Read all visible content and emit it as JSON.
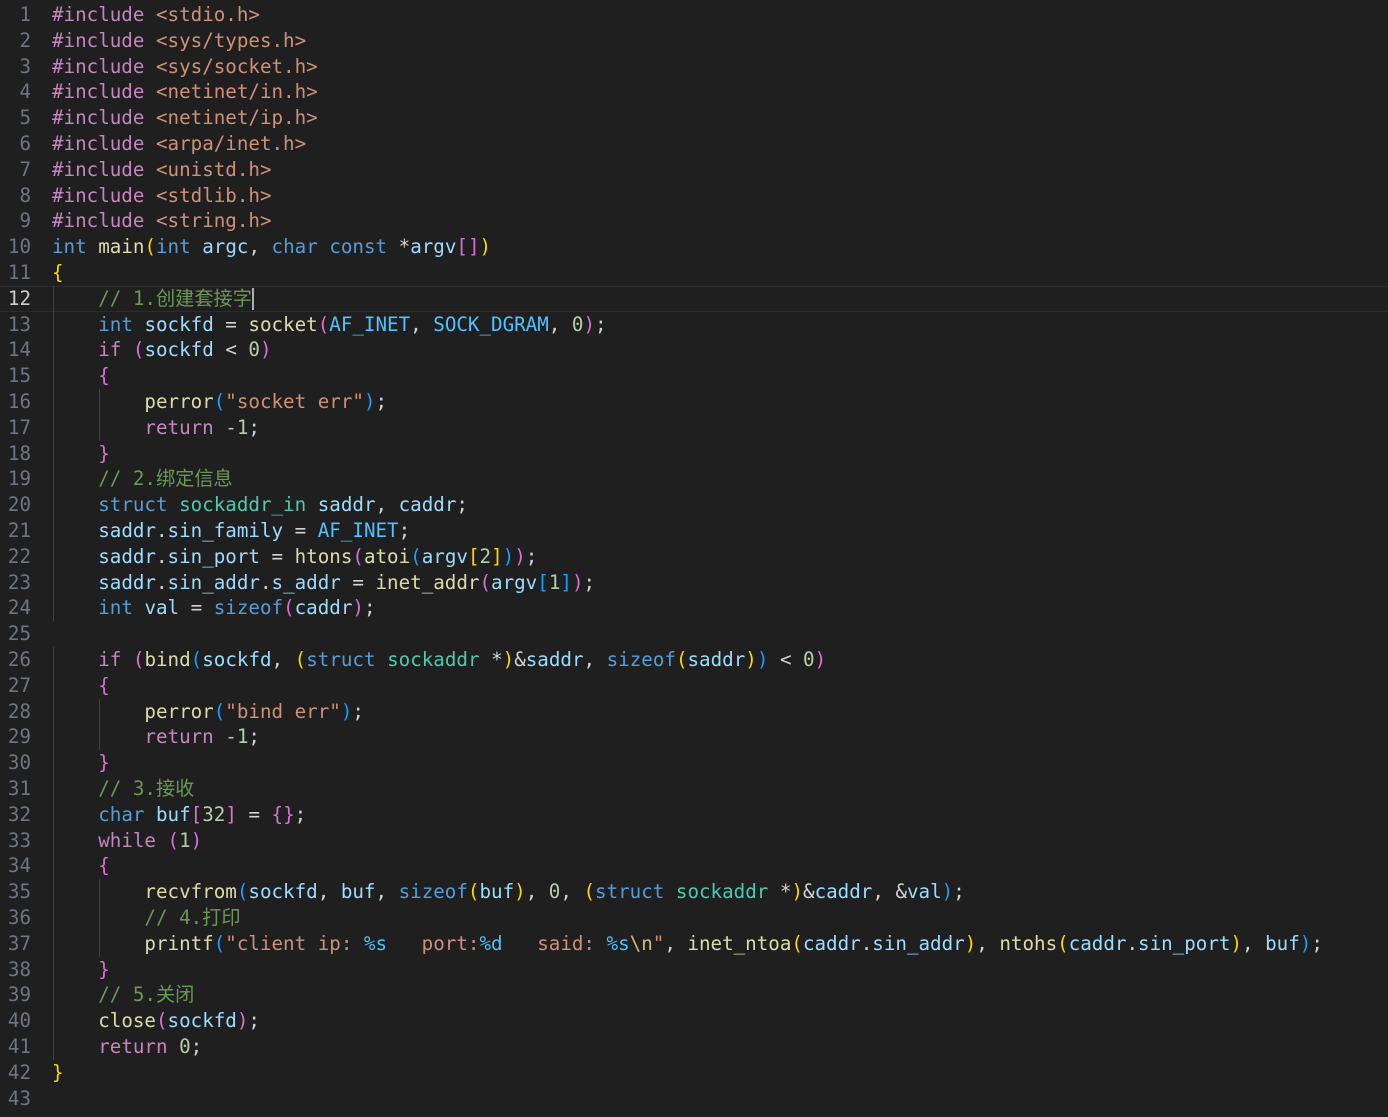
{
  "editor": {
    "language": "c",
    "current_line": 12,
    "colors": {
      "background": "#1f1f1f",
      "line_number": "#6e7681",
      "line_number_active": "#cccccc",
      "keyword_control": "#c586c0",
      "keyword_type": "#569cd6",
      "type_name": "#4ec9b0",
      "function": "#dcdcaa",
      "variable": "#9cdcfe",
      "constant": "#4fc1ff",
      "string": "#ce9178",
      "number": "#b5cea8",
      "comment": "#6a9955",
      "bracket_gold": "#ffd700",
      "bracket_purple": "#da70d6",
      "bracket_blue": "#179fff"
    },
    "lines": [
      [
        [
          "#include",
          "kwc"
        ],
        [
          " ",
          "p"
        ],
        [
          "<stdio.h>",
          "s"
        ]
      ],
      [
        [
          "#include",
          "kwc"
        ],
        [
          " ",
          "p"
        ],
        [
          "<sys/types.h>",
          "s"
        ]
      ],
      [
        [
          "#include",
          "kwc"
        ],
        [
          " ",
          "p"
        ],
        [
          "<sys/socket.h>",
          "s"
        ]
      ],
      [
        [
          "#include",
          "kwc"
        ],
        [
          " ",
          "p"
        ],
        [
          "<netinet/in.h>",
          "s"
        ]
      ],
      [
        [
          "#include",
          "kwc"
        ],
        [
          " ",
          "p"
        ],
        [
          "<netinet/ip.h>",
          "s"
        ]
      ],
      [
        [
          "#include",
          "kwc"
        ],
        [
          " ",
          "p"
        ],
        [
          "<arpa/inet.h>",
          "s"
        ]
      ],
      [
        [
          "#include",
          "kwc"
        ],
        [
          " ",
          "p"
        ],
        [
          "<unistd.h>",
          "s"
        ]
      ],
      [
        [
          "#include",
          "kwc"
        ],
        [
          " ",
          "p"
        ],
        [
          "<stdlib.h>",
          "s"
        ]
      ],
      [
        [
          "#include",
          "kwc"
        ],
        [
          " ",
          "p"
        ],
        [
          "<string.h>",
          "s"
        ]
      ],
      [
        [
          "int",
          "kw"
        ],
        [
          " ",
          "p"
        ],
        [
          "main",
          "f"
        ],
        [
          "(",
          "b1"
        ],
        [
          "int",
          "kw"
        ],
        [
          " ",
          "p"
        ],
        [
          "argc",
          "v"
        ],
        [
          ", ",
          "p"
        ],
        [
          "char",
          "kw"
        ],
        [
          " ",
          "p"
        ],
        [
          "const",
          "kw"
        ],
        [
          " *",
          "p"
        ],
        [
          "argv",
          "v"
        ],
        [
          "[]",
          "b2"
        ],
        [
          ")",
          "b1"
        ]
      ],
      [
        [
          "{",
          "b1"
        ]
      ],
      [
        [
          "    ",
          "p"
        ],
        [
          "// 1.创建套接字",
          "c"
        ]
      ],
      [
        [
          "    ",
          "p"
        ],
        [
          "int",
          "kw"
        ],
        [
          " ",
          "p"
        ],
        [
          "sockfd",
          "v"
        ],
        [
          " = ",
          "p"
        ],
        [
          "socket",
          "f"
        ],
        [
          "(",
          "b2"
        ],
        [
          "AF_INET",
          "k"
        ],
        [
          ", ",
          "p"
        ],
        [
          "SOCK_DGRAM",
          "k"
        ],
        [
          ", ",
          "p"
        ],
        [
          "0",
          "n"
        ],
        [
          ")",
          "b2"
        ],
        [
          ";",
          "p"
        ]
      ],
      [
        [
          "    ",
          "p"
        ],
        [
          "if",
          "kwc"
        ],
        [
          " ",
          "p"
        ],
        [
          "(",
          "b2"
        ],
        [
          "sockfd",
          "v"
        ],
        [
          " < ",
          "p"
        ],
        [
          "0",
          "n"
        ],
        [
          ")",
          "b2"
        ]
      ],
      [
        [
          "    ",
          "p"
        ],
        [
          "{",
          "b2"
        ]
      ],
      [
        [
          "        ",
          "p"
        ],
        [
          "perror",
          "f"
        ],
        [
          "(",
          "b3"
        ],
        [
          "\"socket err\"",
          "s"
        ],
        [
          ")",
          "b3"
        ],
        [
          ";",
          "p"
        ]
      ],
      [
        [
          "        ",
          "p"
        ],
        [
          "return",
          "kwc"
        ],
        [
          " ",
          "p"
        ],
        [
          "-1",
          "n"
        ],
        [
          ";",
          "p"
        ]
      ],
      [
        [
          "    ",
          "p"
        ],
        [
          "}",
          "b2"
        ]
      ],
      [
        [
          "    ",
          "p"
        ],
        [
          "// 2.绑定信息",
          "c"
        ]
      ],
      [
        [
          "    ",
          "p"
        ],
        [
          "struct",
          "kw"
        ],
        [
          " ",
          "p"
        ],
        [
          "sockaddr_in",
          "t"
        ],
        [
          " ",
          "p"
        ],
        [
          "saddr",
          "v"
        ],
        [
          ", ",
          "p"
        ],
        [
          "caddr",
          "v"
        ],
        [
          ";",
          "p"
        ]
      ],
      [
        [
          "    ",
          "p"
        ],
        [
          "saddr",
          "v"
        ],
        [
          ".",
          "p"
        ],
        [
          "sin_family",
          "v"
        ],
        [
          " = ",
          "p"
        ],
        [
          "AF_INET",
          "k"
        ],
        [
          ";",
          "p"
        ]
      ],
      [
        [
          "    ",
          "p"
        ],
        [
          "saddr",
          "v"
        ],
        [
          ".",
          "p"
        ],
        [
          "sin_port",
          "v"
        ],
        [
          " = ",
          "p"
        ],
        [
          "htons",
          "f"
        ],
        [
          "(",
          "b2"
        ],
        [
          "atoi",
          "f"
        ],
        [
          "(",
          "b3"
        ],
        [
          "argv",
          "v"
        ],
        [
          "[",
          "b1"
        ],
        [
          "2",
          "n"
        ],
        [
          "]",
          "b1"
        ],
        [
          ")",
          "b3"
        ],
        [
          ")",
          "b2"
        ],
        [
          ";",
          "p"
        ]
      ],
      [
        [
          "    ",
          "p"
        ],
        [
          "saddr",
          "v"
        ],
        [
          ".",
          "p"
        ],
        [
          "sin_addr",
          "v"
        ],
        [
          ".",
          "p"
        ],
        [
          "s_addr",
          "v"
        ],
        [
          " = ",
          "p"
        ],
        [
          "inet_addr",
          "f"
        ],
        [
          "(",
          "b2"
        ],
        [
          "argv",
          "v"
        ],
        [
          "[",
          "b3"
        ],
        [
          "1",
          "n"
        ],
        [
          "]",
          "b3"
        ],
        [
          ")",
          "b2"
        ],
        [
          ";",
          "p"
        ]
      ],
      [
        [
          "    ",
          "p"
        ],
        [
          "int",
          "kw"
        ],
        [
          " ",
          "p"
        ],
        [
          "val",
          "v"
        ],
        [
          " = ",
          "p"
        ],
        [
          "sizeof",
          "kw"
        ],
        [
          "(",
          "b2"
        ],
        [
          "caddr",
          "v"
        ],
        [
          ")",
          "b2"
        ],
        [
          ";",
          "p"
        ]
      ],
      [],
      [
        [
          "    ",
          "p"
        ],
        [
          "if",
          "kwc"
        ],
        [
          " ",
          "p"
        ],
        [
          "(",
          "b2"
        ],
        [
          "bind",
          "f"
        ],
        [
          "(",
          "b3"
        ],
        [
          "sockfd",
          "v"
        ],
        [
          ", ",
          "p"
        ],
        [
          "(",
          "b1"
        ],
        [
          "struct",
          "kw"
        ],
        [
          " ",
          "p"
        ],
        [
          "sockaddr",
          "t"
        ],
        [
          " *",
          "p"
        ],
        [
          ")",
          "b1"
        ],
        [
          "&",
          "p"
        ],
        [
          "saddr",
          "v"
        ],
        [
          ", ",
          "p"
        ],
        [
          "sizeof",
          "kw"
        ],
        [
          "(",
          "b1"
        ],
        [
          "saddr",
          "v"
        ],
        [
          ")",
          "b1"
        ],
        [
          ")",
          "b3"
        ],
        [
          " < ",
          "p"
        ],
        [
          "0",
          "n"
        ],
        [
          ")",
          "b2"
        ]
      ],
      [
        [
          "    ",
          "p"
        ],
        [
          "{",
          "b2"
        ]
      ],
      [
        [
          "        ",
          "p"
        ],
        [
          "perror",
          "f"
        ],
        [
          "(",
          "b3"
        ],
        [
          "\"bind err\"",
          "s"
        ],
        [
          ")",
          "b3"
        ],
        [
          ";",
          "p"
        ]
      ],
      [
        [
          "        ",
          "p"
        ],
        [
          "return",
          "kwc"
        ],
        [
          " ",
          "p"
        ],
        [
          "-1",
          "n"
        ],
        [
          ";",
          "p"
        ]
      ],
      [
        [
          "    ",
          "p"
        ],
        [
          "}",
          "b2"
        ]
      ],
      [
        [
          "    ",
          "p"
        ],
        [
          "// 3.接收",
          "c"
        ]
      ],
      [
        [
          "    ",
          "p"
        ],
        [
          "char",
          "kw"
        ],
        [
          " ",
          "p"
        ],
        [
          "buf",
          "v"
        ],
        [
          "[",
          "b2"
        ],
        [
          "32",
          "n"
        ],
        [
          "]",
          "b2"
        ],
        [
          " = ",
          "p"
        ],
        [
          "{}",
          "b2"
        ],
        [
          ";",
          "p"
        ]
      ],
      [
        [
          "    ",
          "p"
        ],
        [
          "while",
          "kwc"
        ],
        [
          " ",
          "p"
        ],
        [
          "(",
          "b2"
        ],
        [
          "1",
          "n"
        ],
        [
          ")",
          "b2"
        ]
      ],
      [
        [
          "    ",
          "p"
        ],
        [
          "{",
          "b2"
        ]
      ],
      [
        [
          "        ",
          "p"
        ],
        [
          "recvfrom",
          "f"
        ],
        [
          "(",
          "b3"
        ],
        [
          "sockfd",
          "v"
        ],
        [
          ", ",
          "p"
        ],
        [
          "buf",
          "v"
        ],
        [
          ", ",
          "p"
        ],
        [
          "sizeof",
          "kw"
        ],
        [
          "(",
          "b1"
        ],
        [
          "buf",
          "v"
        ],
        [
          ")",
          "b1"
        ],
        [
          ", ",
          "p"
        ],
        [
          "0",
          "n"
        ],
        [
          ", ",
          "p"
        ],
        [
          "(",
          "b1"
        ],
        [
          "struct",
          "kw"
        ],
        [
          " ",
          "p"
        ],
        [
          "sockaddr",
          "t"
        ],
        [
          " *",
          "p"
        ],
        [
          ")",
          "b1"
        ],
        [
          "&",
          "p"
        ],
        [
          "caddr",
          "v"
        ],
        [
          ", ",
          "p"
        ],
        [
          "&",
          "p"
        ],
        [
          "val",
          "v"
        ],
        [
          ")",
          "b3"
        ],
        [
          ";",
          "p"
        ]
      ],
      [
        [
          "        ",
          "p"
        ],
        [
          "// 4.打印",
          "c"
        ]
      ],
      [
        [
          "        ",
          "p"
        ],
        [
          "printf",
          "f"
        ],
        [
          "(",
          "b3"
        ],
        [
          "\"client ip: ",
          "s"
        ],
        [
          "%s",
          "k"
        ],
        [
          "   port:",
          "s"
        ],
        [
          "%d",
          "k"
        ],
        [
          "   said: ",
          "s"
        ],
        [
          "%s",
          "k"
        ],
        [
          "\\n",
          "e"
        ],
        [
          "\"",
          "s"
        ],
        [
          ", ",
          "p"
        ],
        [
          "inet_ntoa",
          "f"
        ],
        [
          "(",
          "b1"
        ],
        [
          "caddr",
          "v"
        ],
        [
          ".",
          "p"
        ],
        [
          "sin_addr",
          "v"
        ],
        [
          ")",
          "b1"
        ],
        [
          ", ",
          "p"
        ],
        [
          "ntohs",
          "f"
        ],
        [
          "(",
          "b1"
        ],
        [
          "caddr",
          "v"
        ],
        [
          ".",
          "p"
        ],
        [
          "sin_port",
          "v"
        ],
        [
          ")",
          "b1"
        ],
        [
          ", ",
          "p"
        ],
        [
          "buf",
          "v"
        ],
        [
          ")",
          "b3"
        ],
        [
          ";",
          "p"
        ]
      ],
      [
        [
          "    ",
          "p"
        ],
        [
          "}",
          "b2"
        ]
      ],
      [
        [
          "    ",
          "p"
        ],
        [
          "// 5.关闭",
          "c"
        ]
      ],
      [
        [
          "    ",
          "p"
        ],
        [
          "close",
          "f"
        ],
        [
          "(",
          "b2"
        ],
        [
          "sockfd",
          "v"
        ],
        [
          ")",
          "b2"
        ],
        [
          ";",
          "p"
        ]
      ],
      [
        [
          "    ",
          "p"
        ],
        [
          "return",
          "kwc"
        ],
        [
          " ",
          "p"
        ],
        [
          "0",
          "n"
        ],
        [
          ";",
          "p"
        ]
      ],
      [
        [
          "}",
          "b1"
        ]
      ],
      []
    ]
  }
}
